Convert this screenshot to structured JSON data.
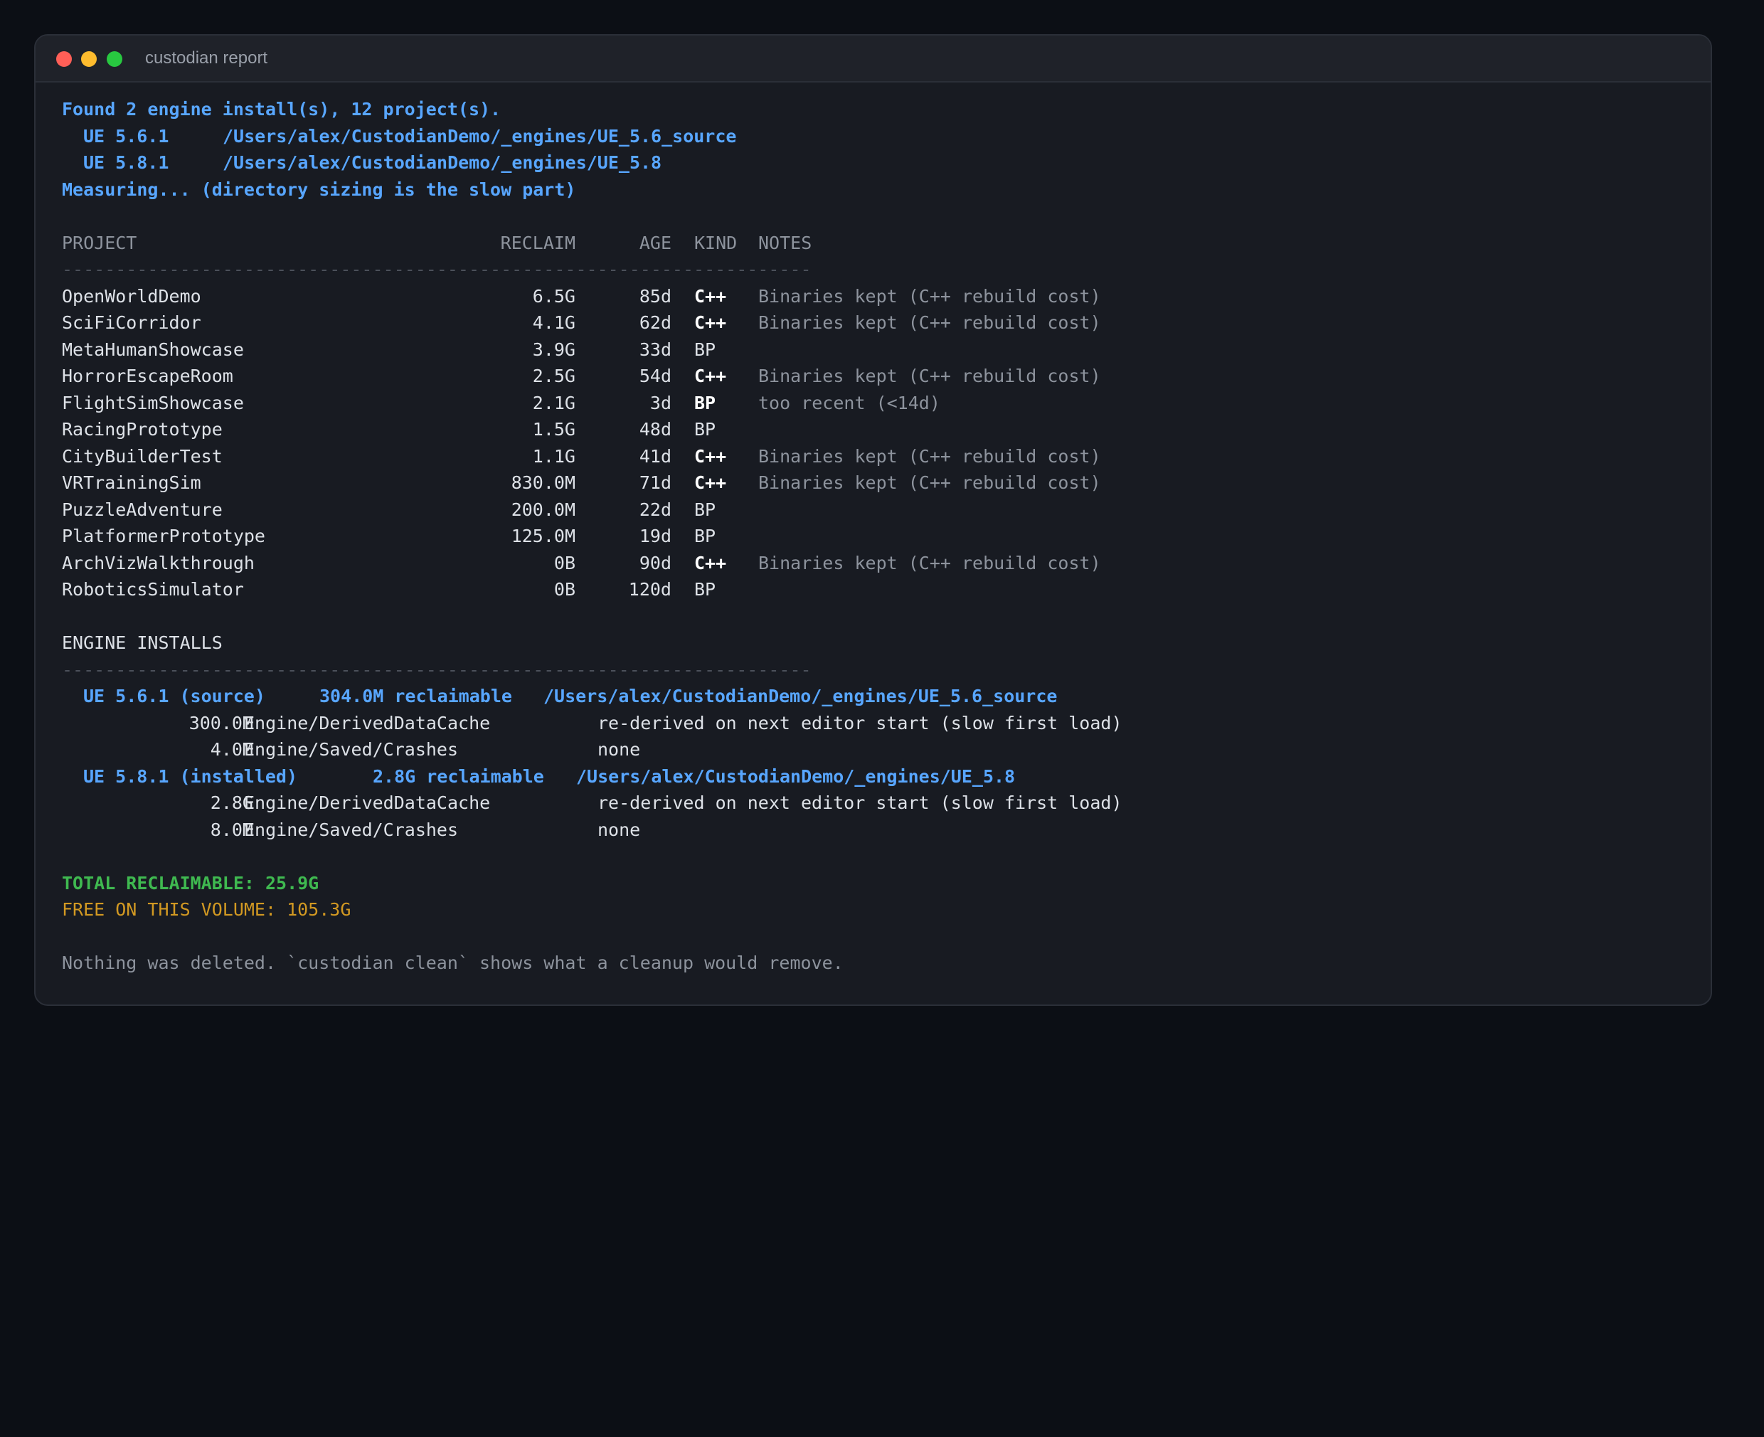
{
  "window": {
    "title": "custodian report"
  },
  "intro": {
    "found_line": "Found 2 engine install(s), 12 project(s).",
    "engines": [
      {
        "version": "UE 5.6.1",
        "path": "/Users/alex/CustodianDemo/_engines/UE_5.6_source"
      },
      {
        "version": "UE 5.8.1",
        "path": "/Users/alex/CustodianDemo/_engines/UE_5.8"
      }
    ],
    "measuring_line": "Measuring... (directory sizing is the slow part)"
  },
  "projects": {
    "headers": {
      "project": "PROJECT",
      "reclaim": "RECLAIM",
      "age": "AGE",
      "kind": "KIND",
      "notes": "NOTES"
    },
    "rule": "----------------------------------------------------------------------",
    "rows": [
      {
        "name": "OpenWorldDemo",
        "reclaim": "6.5G",
        "age": "85d",
        "kind": "C++",
        "kind_bold": true,
        "notes": "Binaries kept (C++ rebuild cost)"
      },
      {
        "name": "SciFiCorridor",
        "reclaim": "4.1G",
        "age": "62d",
        "kind": "C++",
        "kind_bold": true,
        "notes": "Binaries kept (C++ rebuild cost)"
      },
      {
        "name": "MetaHumanShowcase",
        "reclaim": "3.9G",
        "age": "33d",
        "kind": "BP",
        "kind_bold": false,
        "notes": ""
      },
      {
        "name": "HorrorEscapeRoom",
        "reclaim": "2.5G",
        "age": "54d",
        "kind": "C++",
        "kind_bold": true,
        "notes": "Binaries kept (C++ rebuild cost)"
      },
      {
        "name": "FlightSimShowcase",
        "reclaim": "2.1G",
        "age": "3d",
        "kind": "BP",
        "kind_bold": true,
        "notes": "too recent (<14d)"
      },
      {
        "name": "RacingPrototype",
        "reclaim": "1.5G",
        "age": "48d",
        "kind": "BP",
        "kind_bold": false,
        "notes": ""
      },
      {
        "name": "CityBuilderTest",
        "reclaim": "1.1G",
        "age": "41d",
        "kind": "C++",
        "kind_bold": true,
        "notes": "Binaries kept (C++ rebuild cost)"
      },
      {
        "name": "VRTrainingSim",
        "reclaim": "830.0M",
        "age": "71d",
        "kind": "C++",
        "kind_bold": true,
        "notes": "Binaries kept (C++ rebuild cost)"
      },
      {
        "name": "PuzzleAdventure",
        "reclaim": "200.0M",
        "age": "22d",
        "kind": "BP",
        "kind_bold": false,
        "notes": ""
      },
      {
        "name": "PlatformerPrototype",
        "reclaim": "125.0M",
        "age": "19d",
        "kind": "BP",
        "kind_bold": false,
        "notes": ""
      },
      {
        "name": "ArchVizWalkthrough",
        "reclaim": "0B",
        "age": "90d",
        "kind": "C++",
        "kind_bold": true,
        "notes": "Binaries kept (C++ rebuild cost)"
      },
      {
        "name": "RoboticsSimulator",
        "reclaim": "0B",
        "age": "120d",
        "kind": "BP",
        "kind_bold": false,
        "notes": ""
      }
    ]
  },
  "engine_installs": {
    "heading": "ENGINE INSTALLS",
    "rule": "----------------------------------------------------------------------",
    "engines": [
      {
        "label": "UE 5.6.1 (source)",
        "reclaimable": "304.0M reclaimable",
        "path": "/Users/alex/CustodianDemo/_engines/UE_5.6_source",
        "items": [
          {
            "size": "300.0M",
            "dir": "Engine/DerivedDataCache",
            "note": "re-derived on next editor start (slow first load)"
          },
          {
            "size": "4.0M",
            "dir": "Engine/Saved/Crashes",
            "note": "none"
          }
        ]
      },
      {
        "label": "UE 5.8.1 (installed)",
        "reclaimable": "2.8G reclaimable",
        "path": "/Users/alex/CustodianDemo/_engines/UE_5.8",
        "items": [
          {
            "size": "2.8G",
            "dir": "Engine/DerivedDataCache",
            "note": "re-derived on next editor start (slow first load)"
          },
          {
            "size": "8.0M",
            "dir": "Engine/Saved/Crashes",
            "note": "none"
          }
        ]
      }
    ]
  },
  "summary": {
    "total": "TOTAL RECLAIMABLE: 25.9G",
    "free": "FREE ON THIS VOLUME: 105.3G",
    "footer": "Nothing was deleted. `custodian clean` shows what a cleanup would remove."
  }
}
